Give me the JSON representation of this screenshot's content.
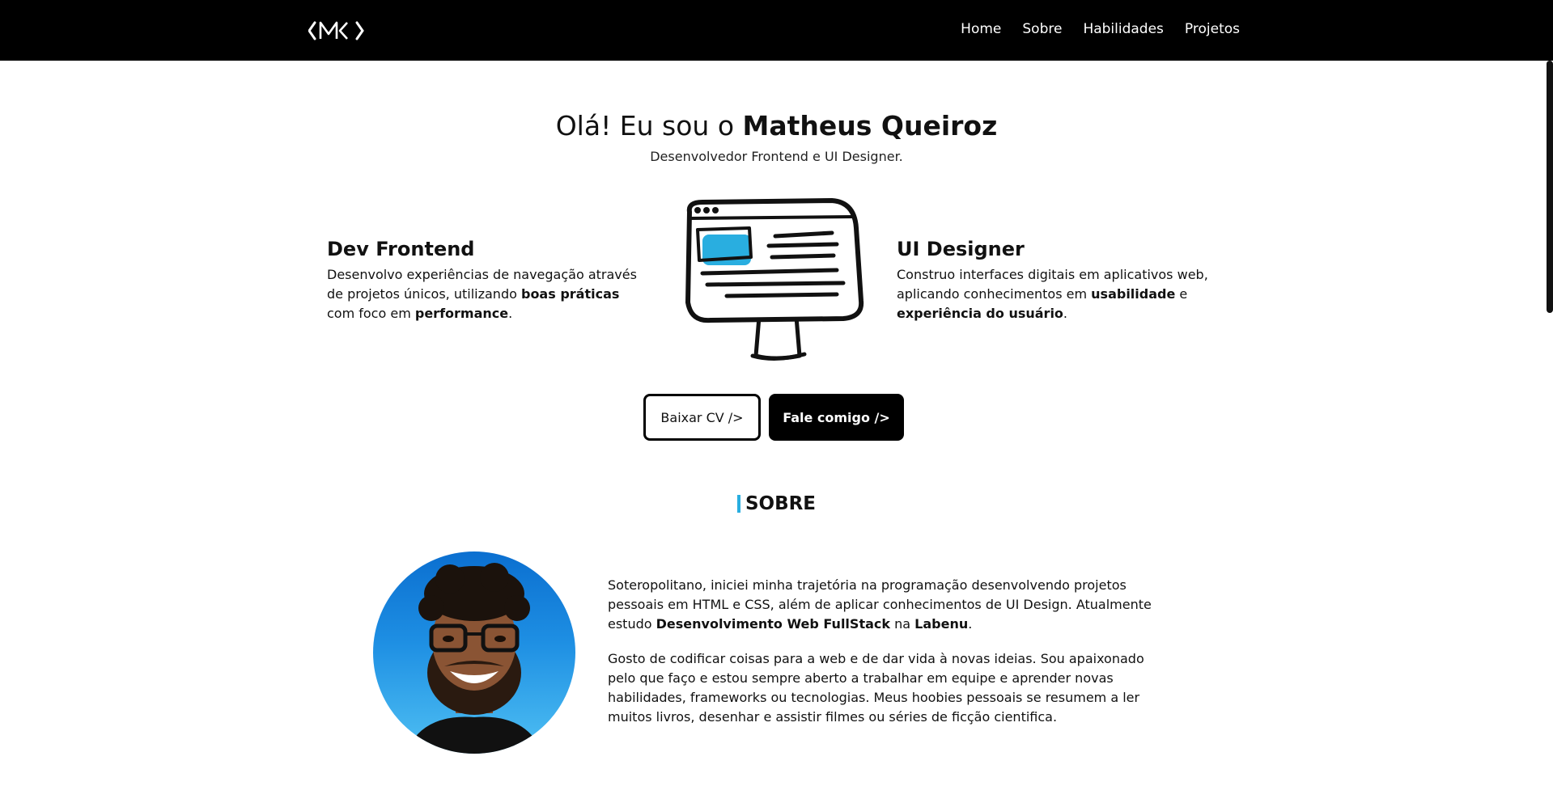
{
  "nav": {
    "logo_name": "logo",
    "items": [
      "Home",
      "Sobre",
      "Habilidades",
      "Projetos"
    ]
  },
  "hero": {
    "title_prefix": "Olá! Eu sou o ",
    "title_name": "Matheus Queiroz",
    "subtitle": "Desenvolvedor Frontend e UI Designer."
  },
  "frontend": {
    "title": "Dev Frontend",
    "text_1": "Desenvolvo experiências de navegação através de projetos únicos, utilizando ",
    "bold_1": "boas práticas",
    "text_2": " com foco em ",
    "bold_2": "performance",
    "text_3": "."
  },
  "designer": {
    "title": "UI Designer",
    "text_1": "Construo interfaces digitais em aplicativos web, aplicando conhecimentos em ",
    "bold_1": "usabilidade",
    "text_2": " e ",
    "bold_2": "experiência do usuário",
    "text_3": "."
  },
  "buttons": {
    "cv": "Baixar CV />",
    "contact": "Fale comigo />"
  },
  "about": {
    "title": "SOBRE",
    "p1_a": "Soteropolitano, iniciei minha trajetória na programação desenvolvendo projetos pessoais em HTML e CSS, além de aplicar conhecimentos de UI Design. Atualmente estudo ",
    "p1_b": "Desenvolvimento Web FullStack",
    "p1_c": " na ",
    "p1_d": "Labenu",
    "p1_e": ".",
    "p2": "Gosto de codificar coisas para a web e de dar vida à novas ideias. Sou apaixonado pelo que faço e estou sempre aberto a trabalhar em equipe e aprender novas habilidades, frameworks ou tecnologias. Meus hoobies pessoais se resumem a ler muitos livros, desenhar e assistir filmes ou séries de ficção cientifica."
  },
  "colors": {
    "accent": "#29aee0",
    "nav_bg": "#000000"
  }
}
